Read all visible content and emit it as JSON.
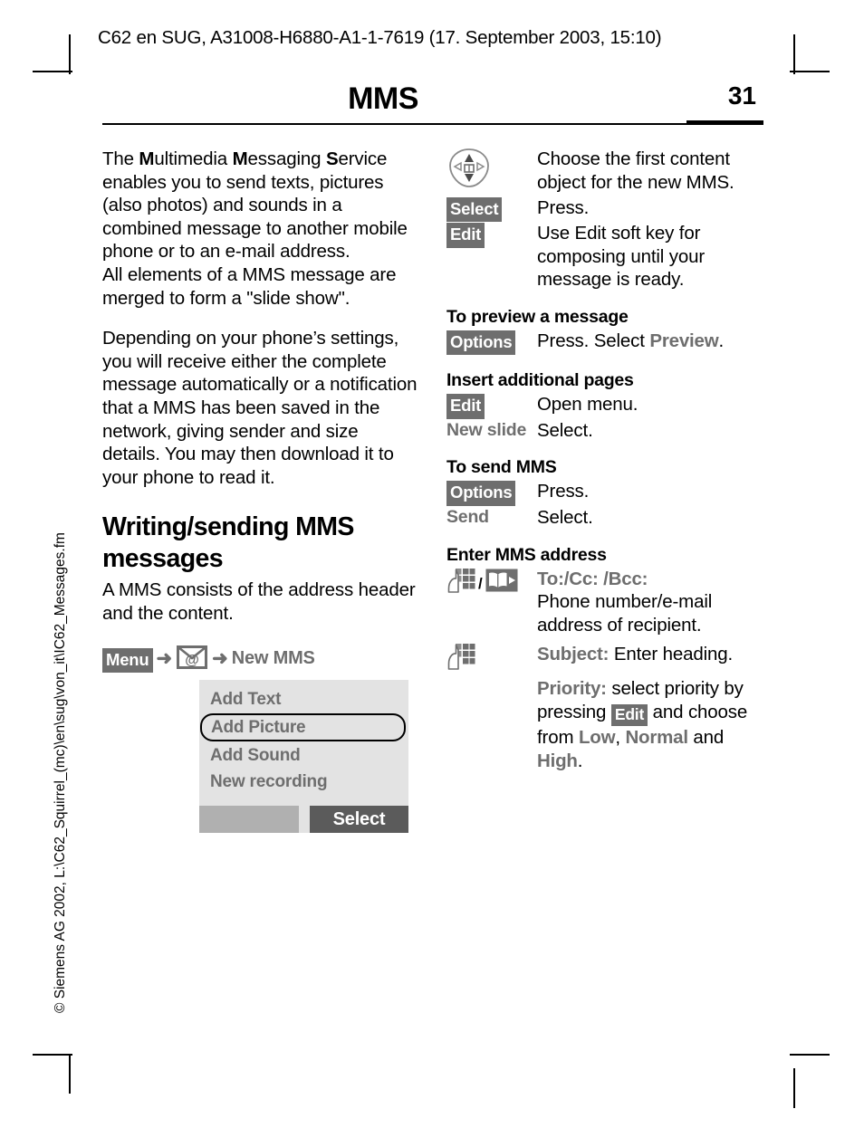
{
  "header": {
    "running_head": "C62 en SUG, A31008-H6880-A1-1-7619 (17. September 2003, 15:10)",
    "chapter_title": "MMS",
    "page_number": "31"
  },
  "side_note": "© Siemens AG 2002, L:\\C62_Squirrel_(mc)\\en\\sug\\von_it\\IC62_Messages.fm",
  "left_column": {
    "intro_p1_a": "The ",
    "intro_p1_m1": "M",
    "intro_p1_b": "ultimedia ",
    "intro_p1_m2": "M",
    "intro_p1_c": "essaging ",
    "intro_p1_s": "S",
    "intro_p1_d": "ervice enables you to send texts, pictures (also photos) and sounds in a combined message to another mobile phone or to an e-mail address.",
    "intro_p1_e": "All elements of a MMS message are merged to form a \"slide show\".",
    "intro_p2": "Depending on your phone’s settings, you will receive either the complete message automatically or a notification that a MMS has been saved in the network, giving sender and size details. You may then download it to your phone to read it.",
    "section_heading": "Writing/sending MMS messages",
    "section_body": "A MMS consists of the address header and the content.",
    "menu_path": {
      "menu_label": "Menu",
      "arrow": "➜",
      "mms_icon": "envelope-at-icon",
      "target": "New MMS"
    },
    "phone_mock": {
      "items": [
        {
          "label": "Add Text",
          "selected": false
        },
        {
          "label": "Add Picture",
          "selected": true
        },
        {
          "label": "Add Sound",
          "selected": false
        },
        {
          "label": "New recording",
          "selected": false
        }
      ],
      "softkey_left": "",
      "softkey_right": "Select"
    }
  },
  "right_column": {
    "steps": [
      {
        "key_type": "icon",
        "key_icon": "navigation-key-icon",
        "key_label": "",
        "desc": "Choose the first content object for the new MMS."
      },
      {
        "key_type": "chip",
        "key_label": "Select",
        "desc": "Press."
      },
      {
        "key_type": "chip",
        "key_label": "Edit",
        "desc": "Use Edit soft key for composing until your message is ready."
      }
    ],
    "sections": [
      {
        "title": "To preview a message",
        "rows": [
          {
            "key_type": "chip",
            "key_label": "Options",
            "desc_pre": "Press. Select ",
            "desc_term": "Preview",
            "desc_post": "."
          }
        ]
      },
      {
        "title": "Insert additional pages",
        "rows": [
          {
            "key_type": "chip",
            "key_label": "Edit",
            "desc_pre": "Open menu.",
            "desc_term": "",
            "desc_post": ""
          },
          {
            "key_type": "term",
            "key_label": "New slide",
            "desc_pre": "Select.",
            "desc_term": "",
            "desc_post": ""
          }
        ]
      },
      {
        "title": "To send MMS",
        "rows": [
          {
            "key_type": "chip",
            "key_label": "Options",
            "desc_pre": "Press.",
            "desc_term": "",
            "desc_post": ""
          },
          {
            "key_type": "term",
            "key_label": "Send",
            "desc_pre": "Select.",
            "desc_term": "",
            "desc_post": ""
          }
        ]
      }
    ],
    "address_section": {
      "title": "Enter MMS address",
      "row1": {
        "key_icon_a": "keypad-hand-icon",
        "key_separator": "/",
        "key_icon_b": "phonebook-icon",
        "term": "To:/Cc: /Bcc:",
        "text": "Phone number/e-mail address of recipient."
      },
      "row2": {
        "key_icon": "keypad-hand-icon",
        "subject_term": "Subject:",
        "subject_text": " Enter heading.",
        "priority_term": "Priority:",
        "priority_text_a": " select priority by pressing ",
        "priority_chip": "Edit",
        "priority_text_b": " and choose from ",
        "priority_low": "Low",
        "priority_comma": ", ",
        "priority_normal": "Normal",
        "priority_text_c": " and ",
        "priority_high": "High",
        "priority_text_d": "."
      }
    }
  },
  "colors": {
    "grey_chip_bg": "#6e6e6e",
    "grey_term": "#6e6e6e",
    "mock_bg": "#e3e3e3",
    "softkey_left_bg": "#b0b0b0",
    "softkey_right_bg": "#5b5b5b"
  }
}
